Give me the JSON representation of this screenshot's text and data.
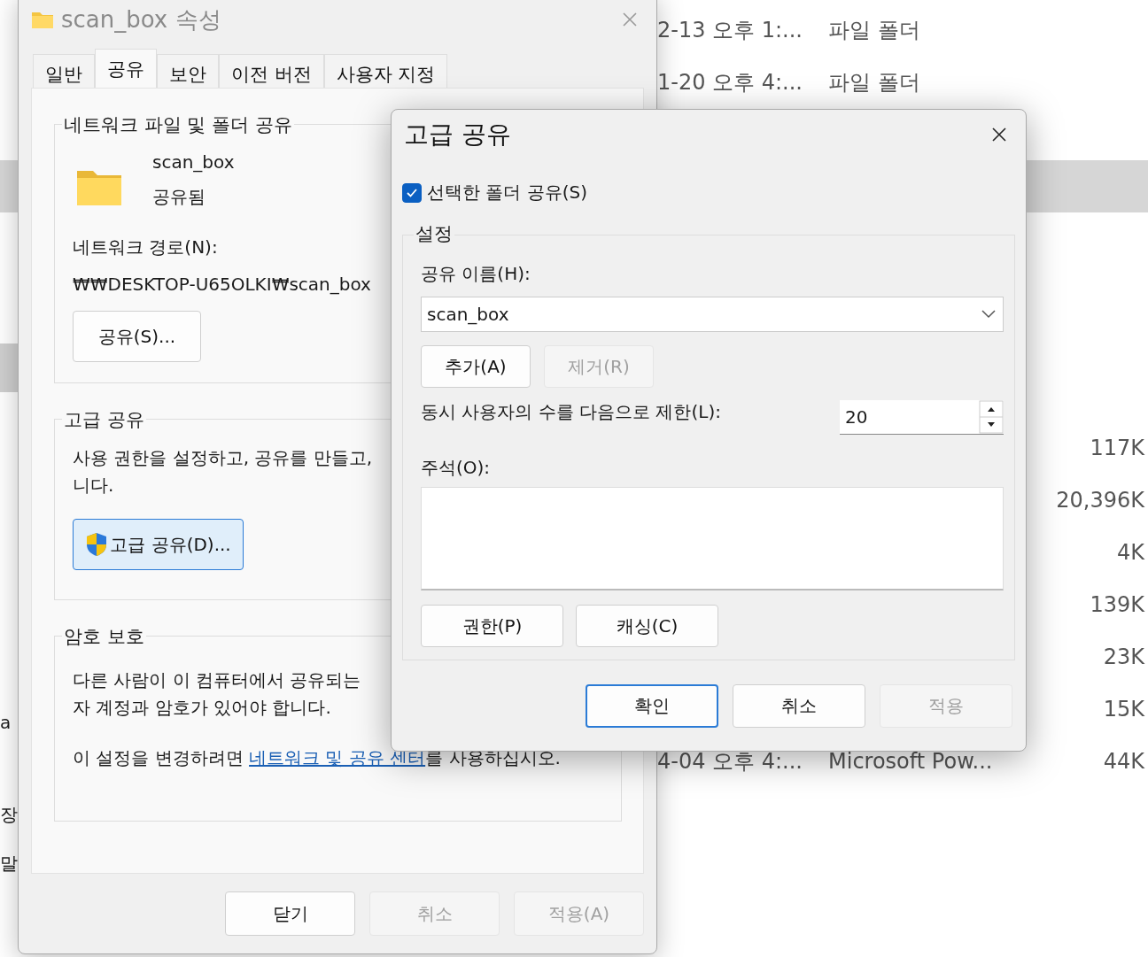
{
  "explorer": {
    "nav_items": [
      {
        "selected": true
      },
      {
        "label": "a",
        "selected": false
      },
      {
        "label": "장",
        "selected": false
      },
      {
        "label": "말",
        "selected": false
      }
    ],
    "rows": [
      {
        "date": "2-13 오후 1:...",
        "type": "파일 폴더",
        "selected": false
      },
      {
        "date": "1-20 오후 4:...",
        "type": "파일 폴더",
        "selected": false
      },
      {
        "selected": false
      },
      {
        "selected": true
      },
      {
        "selected": false
      },
      {
        "selected": false
      },
      {
        "selected": false
      },
      {
        "selected": false
      },
      {
        "size": "117K",
        "selected": false
      },
      {
        "size": "20,396K",
        "selected": false
      },
      {
        "size": "4K",
        "selected": false
      },
      {
        "size": "139K",
        "selected": false
      },
      {
        "size": "23K",
        "selected": false
      },
      {
        "size": "15K",
        "selected": false
      },
      {
        "date": "4-04 오후 4:...",
        "type": "Microsoft Pow...",
        "size": "44K",
        "selected": false
      }
    ]
  },
  "properties": {
    "title": "scan_box 속성",
    "tabs": [
      {
        "label": "일반",
        "selected": false
      },
      {
        "label": "공유",
        "selected": true
      },
      {
        "label": "보안",
        "selected": false
      },
      {
        "label": "이전 버전",
        "selected": false
      },
      {
        "label": "사용자 지정",
        "selected": false
      }
    ],
    "network_group": {
      "legend": "네트워크 파일 및 폴더 공유",
      "folder_name": "scan_box",
      "status": "공유됨",
      "path_label": "네트워크 경로(N):",
      "path": "₩₩DESKTOP-U65OLKI₩scan_box",
      "button": "공유(S)..."
    },
    "advanced_group": {
      "legend": "고급 공유",
      "lines": [
        "사용 권한을 설정하고, 공유를 만들고,",
        "니다."
      ],
      "button": "고급 공유(D)..."
    },
    "password_group": {
      "legend": "암호 보호",
      "lines": [
        "다른 사람이 이 컴퓨터에서 공유되는",
        "자 계정과 암호가 있어야 합니다."
      ],
      "change_before": "이 설정을 변경하려면 ",
      "link": "네트워크 및 공유 센터",
      "change_after": "를 사용하십시오."
    },
    "buttons": [
      {
        "label": "닫기",
        "disabled": false
      },
      {
        "label": "취소",
        "disabled": true
      },
      {
        "label": "적용(A)",
        "disabled": true
      }
    ]
  },
  "advanced_sharing": {
    "title": "고급 공유",
    "share_checkbox": {
      "label": "선택한 폴더 공유(S)",
      "checked": true
    },
    "settings": {
      "legend": "설정",
      "share_name_label": "공유 이름(H):",
      "share_name": "scan_box",
      "name_buttons": [
        {
          "label": "추가(A)",
          "disabled": false
        },
        {
          "label": "제거(R)",
          "disabled": true
        }
      ],
      "limit_label": "동시 사용자의 수를 다음으로 제한(L):",
      "limit_value": "20",
      "comment_label": "주석(O):",
      "buttons": [
        {
          "label": "권한(P)",
          "disabled": false
        },
        {
          "label": "캐싱(C)",
          "disabled": false
        }
      ]
    },
    "buttons": [
      {
        "label": "확인",
        "disabled": false,
        "default": true
      },
      {
        "label": "취소",
        "disabled": false,
        "default": false
      },
      {
        "label": "적용",
        "disabled": true,
        "default": false
      }
    ]
  }
}
